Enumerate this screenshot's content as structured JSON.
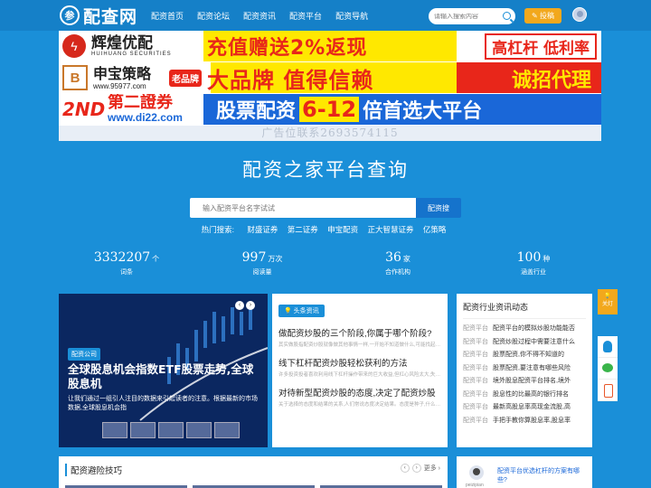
{
  "header": {
    "logo_mark": "参",
    "logo_text": "配查网",
    "nav": [
      "配资首页",
      "配资论坛",
      "配资资讯",
      "配资平台",
      "配资导航"
    ],
    "search_placeholder": "请输入搜索内容",
    "post_button": "投稿"
  },
  "ads": {
    "ad1": {
      "brand_cn": "辉煌优配",
      "brand_en": "HUIHUANG SECURITIES",
      "slogan": "充值赠送2%返现",
      "tag": "高杠杆 低利率"
    },
    "ad2": {
      "logo": "B",
      "brand_cn": "申宝策略",
      "badge": "老品牌",
      "url": "www.95977.com",
      "slogan": "大品牌 值得信赖",
      "tag": "诚招代理"
    },
    "ad3": {
      "logo_main": "2ND",
      "brand_cn": "第二證券",
      "url": "www.di22.com",
      "slogan_a": "股票配资",
      "slogan_b": "6-12",
      "slogan_c": "倍首选大平台"
    },
    "contact": "广告位联系2693574115"
  },
  "hero": {
    "title": "配资之家平台查询",
    "search_placeholder": "输入配资平台名字试试",
    "search_button": "配资搜",
    "hot_label": "热门搜索:",
    "hot_links": [
      "财盛证券",
      "第二证券",
      "申宝配资",
      "正大智慧证券",
      "亿策略"
    ]
  },
  "stats": [
    {
      "num": "3332207",
      "unit": "个",
      "label": "词条"
    },
    {
      "num": "997",
      "unit": "万次",
      "label": "阅读量"
    },
    {
      "num": "36",
      "unit": "家",
      "label": "合作机构"
    },
    {
      "num": "100",
      "unit": "种",
      "label": "涵盖行业"
    }
  ],
  "carousel": {
    "tag": "配资公司",
    "title": "全球股息机会指数ETF股票走势,全球股息机",
    "desc": "让我们通过一组引人注目的数据来引起读者的注意。根据最新的市场数据,全球股息机会指"
  },
  "news": {
    "tab": "头条资讯",
    "items": [
      {
        "title": "做配资炒股的三个阶段,你属于哪个阶段?",
        "desc": "其实做股指配资炒股就像做其他事情一样,一开始不知道做什么,可能找起来很辛苦。然"
      },
      {
        "title": "线下杠杆配资炒股轻松获利的方法",
        "desc": "许多投资投者喜欢利用线下杠杆操作带来的巨大收益,但杠心风险太大,失去许多杠杆操作带"
      },
      {
        "title": "对待新型配资炒股的态度,决定了配资炒股",
        "desc": "关于选择的态度和结果的关系,人们常说态度决定结果。态度是种子,什么样的态度会产生什么样"
      }
    ]
  },
  "dynamic": {
    "title": "配资行业资讯动态",
    "prefix": "配资平台",
    "rows": [
      "配资平台的模拟炒股功能能否",
      "配资炒股过程中需要注意什么",
      "股票配资,你不得不知道的",
      "股票配资,要注意有哪些风险",
      "境外股息配资平台排名,境外",
      "股息性的比最高的银行排名",
      "最新高股息率高现金流股,高",
      "手把手教你算股息率,股息率"
    ]
  },
  "side": {
    "fav": "关灯"
  },
  "bottom": {
    "left_title": "配资避险技巧",
    "more": "更多",
    "right_user": "peizipian",
    "right_question": "配资平台优选杠杆的方案有哪些?"
  },
  "colors": {
    "primary": "#1a8fd8",
    "accent": "#f2a81d",
    "ad_red": "#e8261a",
    "ad_yellow": "#ffe800"
  }
}
